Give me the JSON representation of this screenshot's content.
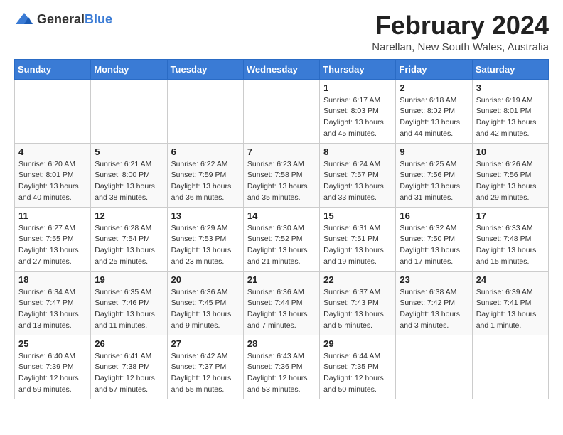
{
  "logo": {
    "text_general": "General",
    "text_blue": "Blue"
  },
  "title": "February 2024",
  "subtitle": "Narellan, New South Wales, Australia",
  "weekdays": [
    "Sunday",
    "Monday",
    "Tuesday",
    "Wednesday",
    "Thursday",
    "Friday",
    "Saturday"
  ],
  "weeks": [
    [
      {
        "day": "",
        "info": ""
      },
      {
        "day": "",
        "info": ""
      },
      {
        "day": "",
        "info": ""
      },
      {
        "day": "",
        "info": ""
      },
      {
        "day": "1",
        "info": "Sunrise: 6:17 AM\nSunset: 8:03 PM\nDaylight: 13 hours\nand 45 minutes."
      },
      {
        "day": "2",
        "info": "Sunrise: 6:18 AM\nSunset: 8:02 PM\nDaylight: 13 hours\nand 44 minutes."
      },
      {
        "day": "3",
        "info": "Sunrise: 6:19 AM\nSunset: 8:01 PM\nDaylight: 13 hours\nand 42 minutes."
      }
    ],
    [
      {
        "day": "4",
        "info": "Sunrise: 6:20 AM\nSunset: 8:01 PM\nDaylight: 13 hours\nand 40 minutes."
      },
      {
        "day": "5",
        "info": "Sunrise: 6:21 AM\nSunset: 8:00 PM\nDaylight: 13 hours\nand 38 minutes."
      },
      {
        "day": "6",
        "info": "Sunrise: 6:22 AM\nSunset: 7:59 PM\nDaylight: 13 hours\nand 36 minutes."
      },
      {
        "day": "7",
        "info": "Sunrise: 6:23 AM\nSunset: 7:58 PM\nDaylight: 13 hours\nand 35 minutes."
      },
      {
        "day": "8",
        "info": "Sunrise: 6:24 AM\nSunset: 7:57 PM\nDaylight: 13 hours\nand 33 minutes."
      },
      {
        "day": "9",
        "info": "Sunrise: 6:25 AM\nSunset: 7:56 PM\nDaylight: 13 hours\nand 31 minutes."
      },
      {
        "day": "10",
        "info": "Sunrise: 6:26 AM\nSunset: 7:56 PM\nDaylight: 13 hours\nand 29 minutes."
      }
    ],
    [
      {
        "day": "11",
        "info": "Sunrise: 6:27 AM\nSunset: 7:55 PM\nDaylight: 13 hours\nand 27 minutes."
      },
      {
        "day": "12",
        "info": "Sunrise: 6:28 AM\nSunset: 7:54 PM\nDaylight: 13 hours\nand 25 minutes."
      },
      {
        "day": "13",
        "info": "Sunrise: 6:29 AM\nSunset: 7:53 PM\nDaylight: 13 hours\nand 23 minutes."
      },
      {
        "day": "14",
        "info": "Sunrise: 6:30 AM\nSunset: 7:52 PM\nDaylight: 13 hours\nand 21 minutes."
      },
      {
        "day": "15",
        "info": "Sunrise: 6:31 AM\nSunset: 7:51 PM\nDaylight: 13 hours\nand 19 minutes."
      },
      {
        "day": "16",
        "info": "Sunrise: 6:32 AM\nSunset: 7:50 PM\nDaylight: 13 hours\nand 17 minutes."
      },
      {
        "day": "17",
        "info": "Sunrise: 6:33 AM\nSunset: 7:48 PM\nDaylight: 13 hours\nand 15 minutes."
      }
    ],
    [
      {
        "day": "18",
        "info": "Sunrise: 6:34 AM\nSunset: 7:47 PM\nDaylight: 13 hours\nand 13 minutes."
      },
      {
        "day": "19",
        "info": "Sunrise: 6:35 AM\nSunset: 7:46 PM\nDaylight: 13 hours\nand 11 minutes."
      },
      {
        "day": "20",
        "info": "Sunrise: 6:36 AM\nSunset: 7:45 PM\nDaylight: 13 hours\nand 9 minutes."
      },
      {
        "day": "21",
        "info": "Sunrise: 6:36 AM\nSunset: 7:44 PM\nDaylight: 13 hours\nand 7 minutes."
      },
      {
        "day": "22",
        "info": "Sunrise: 6:37 AM\nSunset: 7:43 PM\nDaylight: 13 hours\nand 5 minutes."
      },
      {
        "day": "23",
        "info": "Sunrise: 6:38 AM\nSunset: 7:42 PM\nDaylight: 13 hours\nand 3 minutes."
      },
      {
        "day": "24",
        "info": "Sunrise: 6:39 AM\nSunset: 7:41 PM\nDaylight: 13 hours\nand 1 minute."
      }
    ],
    [
      {
        "day": "25",
        "info": "Sunrise: 6:40 AM\nSunset: 7:39 PM\nDaylight: 12 hours\nand 59 minutes."
      },
      {
        "day": "26",
        "info": "Sunrise: 6:41 AM\nSunset: 7:38 PM\nDaylight: 12 hours\nand 57 minutes."
      },
      {
        "day": "27",
        "info": "Sunrise: 6:42 AM\nSunset: 7:37 PM\nDaylight: 12 hours\nand 55 minutes."
      },
      {
        "day": "28",
        "info": "Sunrise: 6:43 AM\nSunset: 7:36 PM\nDaylight: 12 hours\nand 53 minutes."
      },
      {
        "day": "29",
        "info": "Sunrise: 6:44 AM\nSunset: 7:35 PM\nDaylight: 12 hours\nand 50 minutes."
      },
      {
        "day": "",
        "info": ""
      },
      {
        "day": "",
        "info": ""
      }
    ]
  ]
}
